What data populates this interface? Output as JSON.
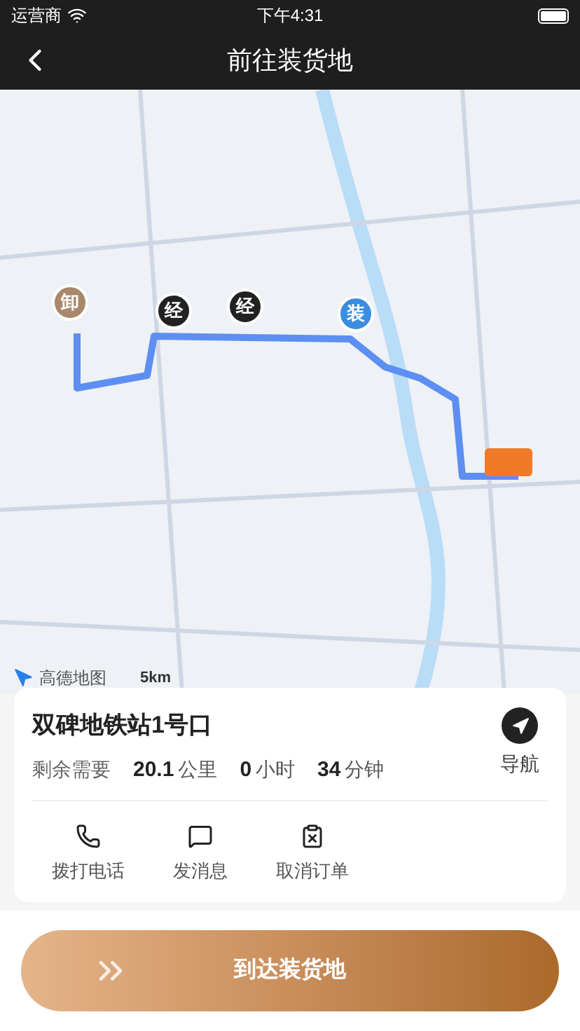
{
  "status_bar": {
    "carrier": "运营商",
    "time": "下午4:31"
  },
  "nav": {
    "title": "前往装货地"
  },
  "map": {
    "markers": [
      {
        "label": "卸",
        "kind": "unload"
      },
      {
        "label": "经",
        "kind": "via"
      },
      {
        "label": "经",
        "kind": "via"
      },
      {
        "label": "装",
        "kind": "load"
      }
    ],
    "logo": "高德地图",
    "scale": "5km"
  },
  "destination": {
    "name": "双碑地铁站1号口",
    "remaining_label": "剩余需要",
    "metrics": [
      {
        "value": "20.1",
        "unit": "公里"
      },
      {
        "value": "0",
        "unit": "小时"
      },
      {
        "value": "34",
        "unit": "分钟"
      }
    ],
    "navigate": "导航"
  },
  "actions": [
    {
      "label": "拨打电话",
      "kind": "call"
    },
    {
      "label": "发消息",
      "kind": "message"
    },
    {
      "label": "取消订单",
      "kind": "cancel"
    }
  ],
  "arrive_button": "到达装货地"
}
